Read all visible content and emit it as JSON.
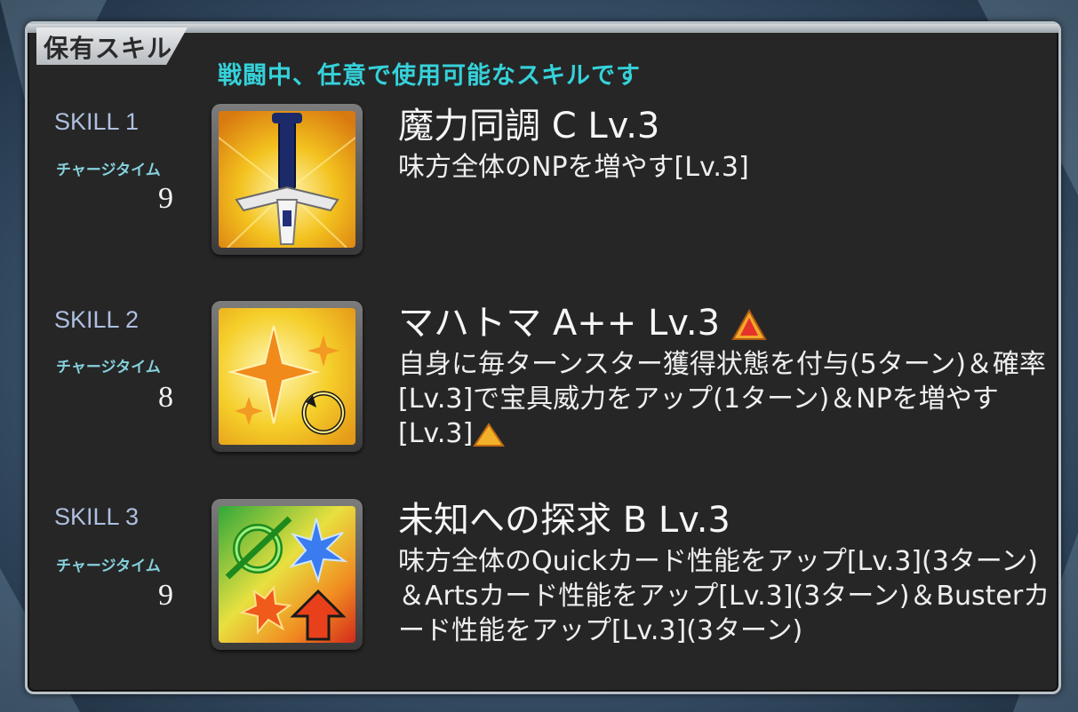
{
  "panel": {
    "title": "保有スキル",
    "subtitle": "戦闘中、任意で使用可能なスキルです"
  },
  "skills": [
    {
      "label": "SKILL 1",
      "charge_label": "チャージタイム",
      "charge_value": "9",
      "name": "魔力同調 C Lv.3",
      "desc": "味方全体のNPを増やす[Lv.3]",
      "icon": "sword-icon"
    },
    {
      "label": "SKILL 2",
      "charge_label": "チャージタイム",
      "charge_value": "8",
      "name": "マハトマ A++ Lv.3",
      "desc": "自身に毎ターンスター獲得状態を付与(5ターン)＆確率[Lv.3]で宝具威力をアップ(1ターン)＆NPを増やす[Lv.3]",
      "icon": "star-icon"
    },
    {
      "label": "SKILL 3",
      "charge_label": "チャージタイム",
      "charge_value": "9",
      "name": "未知への探求 B Lv.3",
      "desc": "味方全体のQuickカード性能をアップ[Lv.3](3ターン)＆Artsカード性能をアップ[Lv.3](3ターン)＆Busterカード性能をアップ[Lv.3](3ターン)",
      "icon": "card-buff-icon"
    }
  ],
  "colors": {
    "subtitle": "#35d2da",
    "skill_label": "#aebfe0",
    "panel_bg": "#262626",
    "upgrade_arrow": "#e8a020"
  }
}
